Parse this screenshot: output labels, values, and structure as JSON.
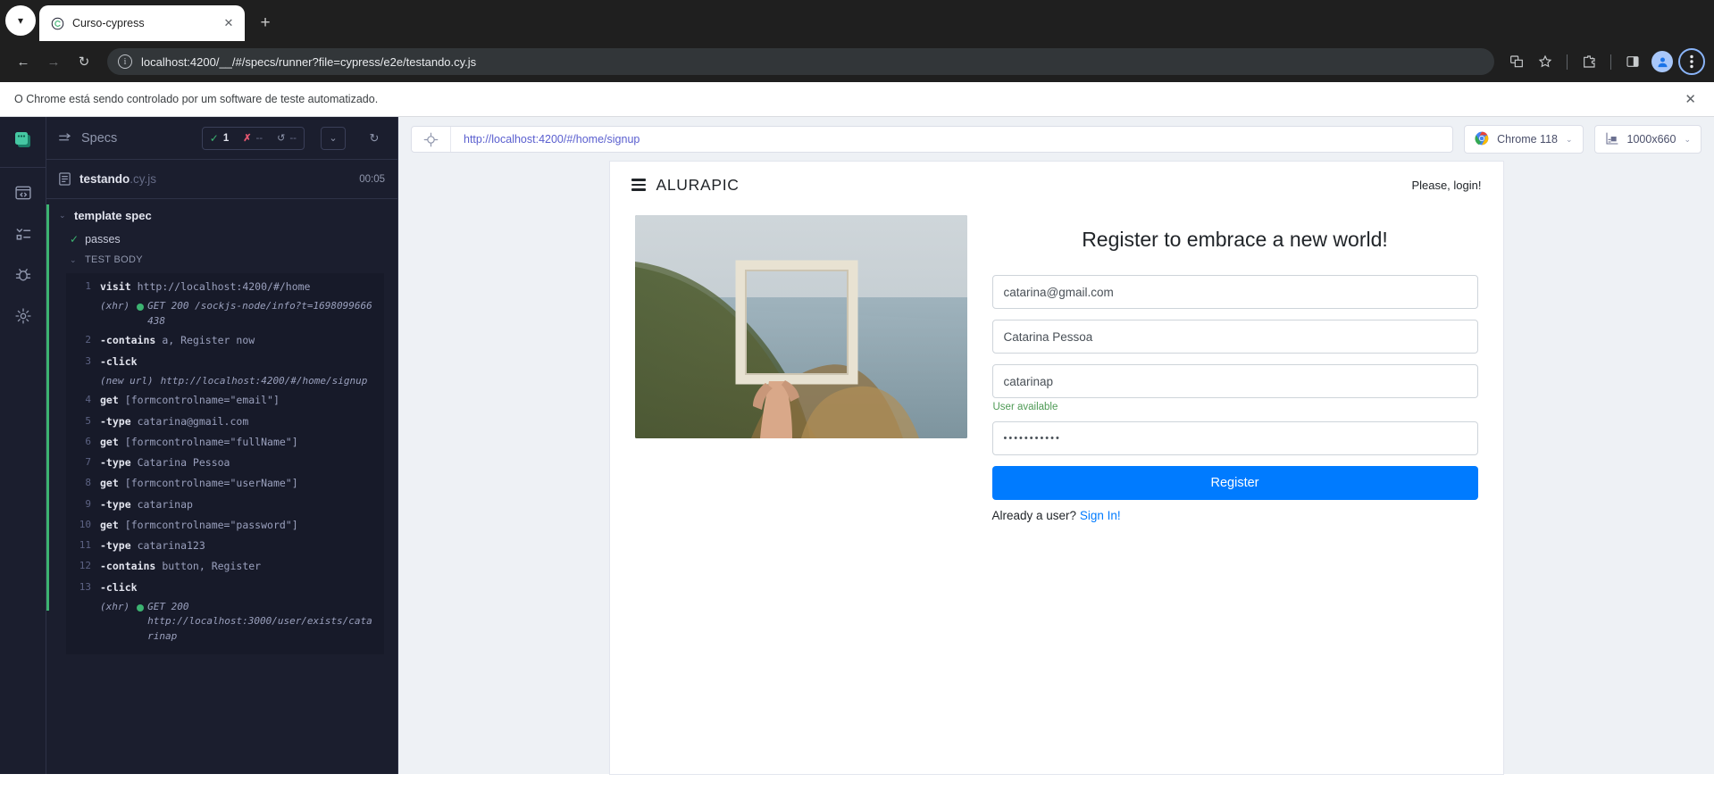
{
  "browser": {
    "tab": {
      "title": "Curso-cypress",
      "favicon": "cypress-icon",
      "close_label": "✕"
    },
    "new_tab_label": "+",
    "tab_list_chevron": "▾",
    "nav": {
      "back": "←",
      "forward": "→",
      "reload": "↻"
    },
    "omnibox": {
      "url": "localhost:4200/__/#/specs/runner?file=cypress/e2e/testando.cy.js",
      "info_icon": "site-info-icon"
    },
    "actions": [
      "translate-icon",
      "bookmark-star-icon",
      "extensions-icon",
      "side-panel-icon",
      "profile-avatar-icon",
      "chrome-menu-icon"
    ],
    "infobar": {
      "text": "O Chrome está sendo controlado por um software de teste automatizado.",
      "close": "✕"
    }
  },
  "rail": {
    "logo": "cypress-logo",
    "items": [
      "specs-icon",
      "runs-icon",
      "debug-icon",
      "settings-icon"
    ]
  },
  "specs": {
    "header_title": "Specs",
    "header_icon": "specs-arrow-icon",
    "stats": [
      {
        "icon": "check-icon",
        "value": "1"
      },
      {
        "icon": "x-icon",
        "value": "--"
      },
      {
        "icon": "pending-icon",
        "value": "--"
      }
    ],
    "controls": {
      "chevron": "⌄",
      "reload": "↻"
    },
    "file": {
      "name": "testando",
      "ext": ".cy.js",
      "duration": "00:05",
      "icon": "file-icon"
    },
    "suite": {
      "name": "template spec",
      "chevron": "⌄"
    },
    "test": {
      "name": "passes",
      "status_icon": "check-icon"
    },
    "test_body_label": "TEST BODY",
    "test_body_chevron": "⌄",
    "commands": [
      {
        "num": "1",
        "kw": "visit",
        "arg": "http://localhost:4200/#/home"
      },
      {
        "log": "(xhr)",
        "dot": true,
        "txt": "GET 200 /sockjs-node/info?t=1698099666438"
      },
      {
        "num": "2",
        "kw": "-contains",
        "arg": "a, Register now"
      },
      {
        "num": "3",
        "kw": "-click",
        "arg": ""
      },
      {
        "log": "(new url)",
        "dot": false,
        "txt": "http://localhost:4200/#/home/signup"
      },
      {
        "num": "4",
        "kw": "get",
        "arg": "[formcontrolname=\"email\"]"
      },
      {
        "num": "5",
        "kw": "-type",
        "arg": "catarina@gmail.com"
      },
      {
        "num": "6",
        "kw": "get",
        "arg": "[formcontrolname=\"fullName\"]"
      },
      {
        "num": "7",
        "kw": "-type",
        "arg": "Catarina Pessoa"
      },
      {
        "num": "8",
        "kw": "get",
        "arg": "[formcontrolname=\"userName\"]"
      },
      {
        "num": "9",
        "kw": "-type",
        "arg": "catarinap"
      },
      {
        "num": "10",
        "kw": "get",
        "arg": "[formcontrolname=\"password\"]"
      },
      {
        "num": "11",
        "kw": "-type",
        "arg": "catarina123"
      },
      {
        "num": "12",
        "kw": "-contains",
        "arg": "button, Register"
      },
      {
        "num": "13",
        "kw": "-click",
        "arg": ""
      },
      {
        "log": "(xhr)",
        "dot": true,
        "txt": "GET 200\nhttp://localhost:3000/user/exists/catarinap"
      }
    ]
  },
  "aut_toolbar": {
    "url": "http://localhost:4200/#/home/signup",
    "selector_icon": "selector-playground-icon",
    "browser": {
      "label": "Chrome 118",
      "icon": "chrome-icon",
      "chevron": "⌄"
    },
    "viewport": {
      "label": "1000x660",
      "icon": "viewport-icon",
      "chevron": "⌄"
    }
  },
  "app": {
    "brand": "ALURAPIC",
    "menu_icon": "hamburger-icon",
    "login_text": "Please, login!",
    "photo_alt": "hand-holding-frame-photo",
    "form": {
      "title": "Register to embrace a new world!",
      "email": "catarina@gmail.com",
      "full_name": "Catarina Pessoa",
      "user_name": "catarinap",
      "user_helper": "User available",
      "password": "•••••••••••",
      "submit_label": "Register",
      "already_text": "Already a user? ",
      "signin_link": "Sign In!"
    }
  },
  "colors": {
    "cypress_bg": "#1b1e2e",
    "cypress_panel": "#171a29",
    "pass_green": "#3cb371",
    "fail_red": "#e45770",
    "primary_blue": "#007bff",
    "url_purple": "#5a5fcf"
  }
}
